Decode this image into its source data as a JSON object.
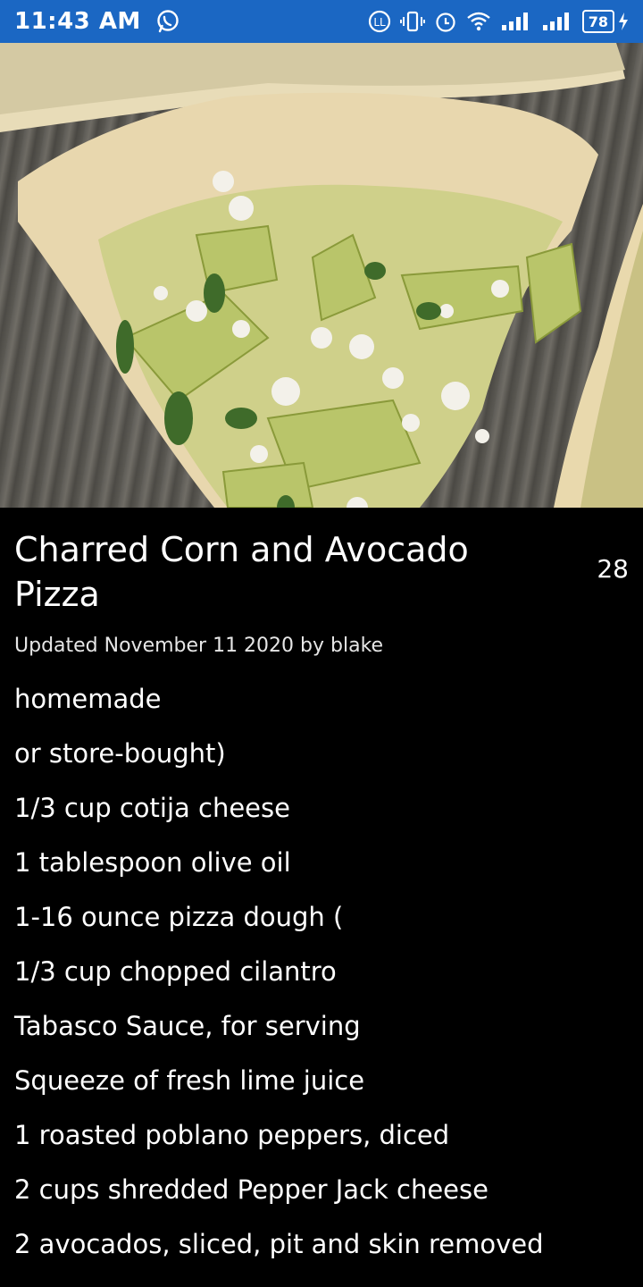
{
  "status_bar": {
    "time": "11:43 AM",
    "battery_level": "78"
  },
  "recipe": {
    "title": "Charred Corn and Avocado Pizza",
    "count": "28",
    "updated": "Updated November 11 2020 by blake",
    "ingredients": [
      "homemade",
      "or store-bought)",
      "1/3 cup cotija cheese",
      "1 tablespoon olive oil",
      "1-16 ounce pizza dough (",
      "1/3 cup chopped cilantro",
      "Tabasco Sauce, for serving",
      "Squeeze of fresh lime juice",
      "1 roasted poblano peppers, diced",
      "2 cups shredded Pepper Jack cheese",
      "2 avocados, sliced, pit and skin removed"
    ]
  },
  "colors": {
    "status_bar": "#1b67c3",
    "background": "#000000",
    "text": "#ffffff"
  }
}
